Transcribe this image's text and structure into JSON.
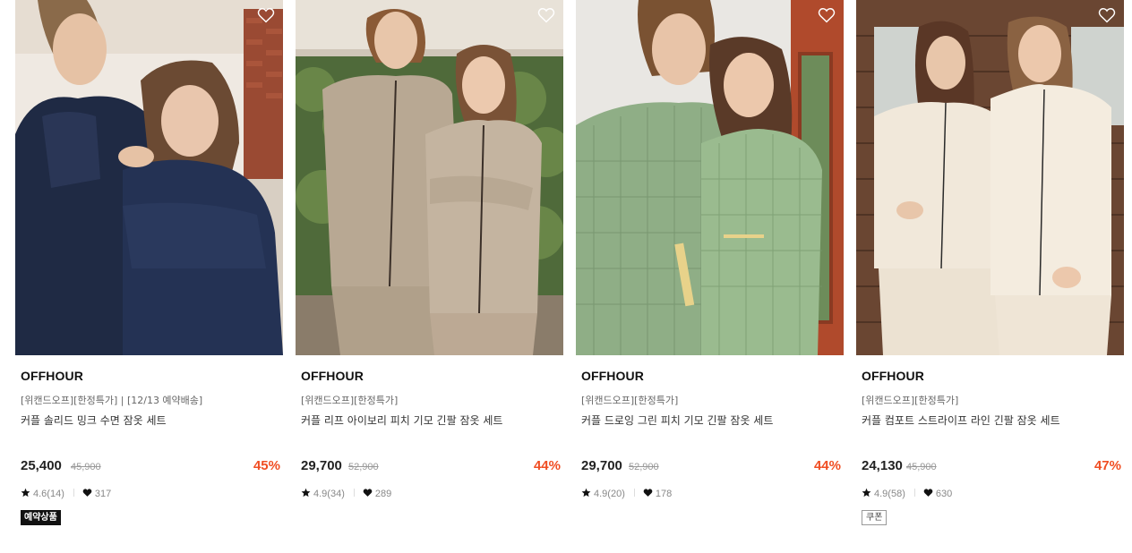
{
  "products": [
    {
      "brand": "OFFHOUR",
      "tagline": "[위캔드오프][한정특가] | [12/13 예약배송]",
      "name": "커플 솔리드 밍크 수면 잠옷 세트",
      "price": "25,400",
      "original_price": "45,900",
      "discount": "45%",
      "rating": "4.6(14)",
      "likes": "317",
      "badge": "예약상품",
      "badge_style": "dark",
      "photo_theme": "navy-mink"
    },
    {
      "brand": "OFFHOUR",
      "tagline": "[위캔드오프][한정특가]",
      "name": "커플 리프 아이보리 피치 기모 긴팔 잠옷 세트",
      "price": "29,700",
      "original_price": "52,900",
      "discount": "44%",
      "rating": "4.9(34)",
      "likes": "289",
      "badge": "",
      "badge_style": "none",
      "photo_theme": "ivory-leaf"
    },
    {
      "brand": "OFFHOUR",
      "tagline": "[위캔드오프][한정특가]",
      "name": "커플 드로잉 그린 피치 기모 긴팔 잠옷 세트",
      "price": "29,700",
      "original_price": "52,900",
      "discount": "44%",
      "rating": "4.9(20)",
      "likes": "178",
      "badge": "",
      "badge_style": "none",
      "photo_theme": "green-check"
    },
    {
      "brand": "OFFHOUR",
      "tagline": "[위캔드오프][한정특가]",
      "name": "커플 컴포트 스트라이프 라인 긴팔 잠옷 세트",
      "price": "24,130",
      "original_price": "45,900",
      "discount": "47%",
      "rating": "4.9(58)",
      "likes": "630",
      "badge": "쿠폰",
      "badge_style": "line",
      "photo_theme": "cream-stripe"
    }
  ],
  "icons": {
    "wishlist": "heart-outline-icon",
    "rating": "star-icon",
    "likes": "heart-filled-icon"
  },
  "colors": {
    "discount": "#f04e23",
    "price": "#222222",
    "original_price": "#999999"
  }
}
